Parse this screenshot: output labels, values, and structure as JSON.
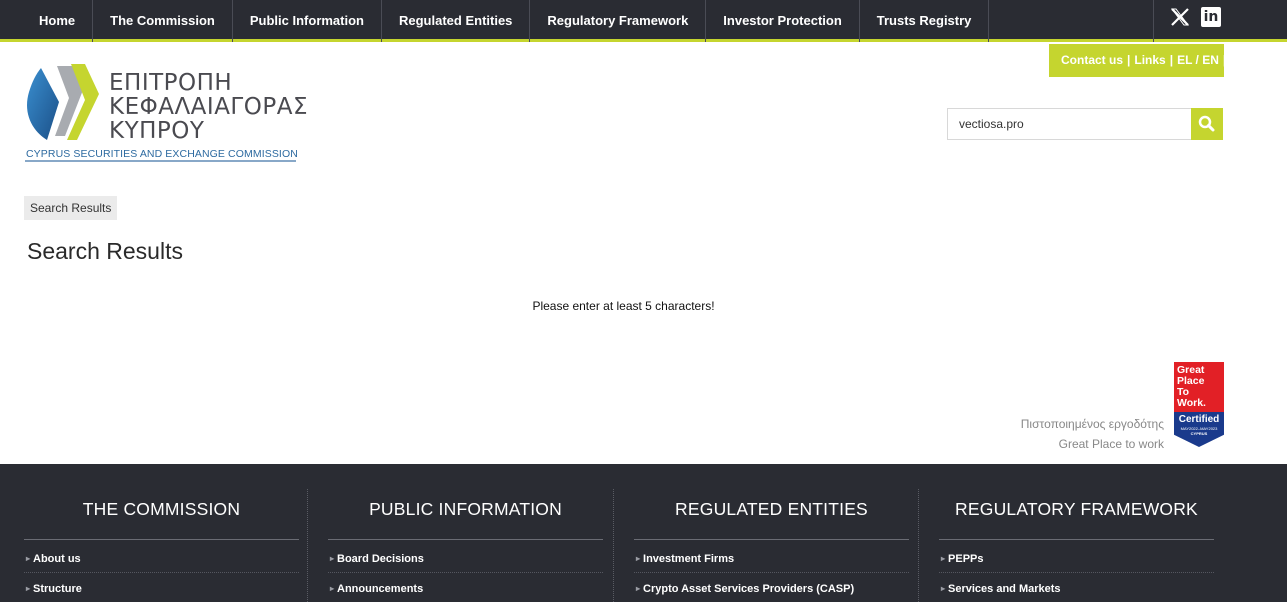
{
  "nav": {
    "items": [
      "Home",
      "The Commission",
      "Public Information",
      "Regulated Entities",
      "Regulatory Framework",
      "Investor Protection",
      "Trusts Registry"
    ]
  },
  "social": {
    "icons": [
      "x-icon",
      "linkedin-icon"
    ],
    "linkedin_glyph": "in"
  },
  "contact": {
    "contact_label": "Contact us",
    "links_label": "Links",
    "lang_label": "EL / EN",
    "sep": "|"
  },
  "logo": {
    "greek_line1": "ΕΠΙΤΡΟΠΗ",
    "greek_line2": "ΚΕΦΑΛΑΙΑΓΟΡΑΣ",
    "greek_line3": "ΚΥΠΡΟΥ",
    "english": "CYPRUS SECURITIES AND EXCHANGE COMMISSION"
  },
  "search": {
    "value": "vectiosa.pro",
    "button_icon": "search-icon"
  },
  "breadcrumb": "Search Results",
  "heading": "Search Results",
  "message": "Please enter at least 5 characters!",
  "gptw": {
    "line1": "Πιστοποιημένος εργοδότης",
    "line2": "Great Place to work",
    "badge_l1": "Great",
    "badge_l2": "Place",
    "badge_l3": "To",
    "badge_l4": "Work.",
    "badge_cert": "Certified",
    "badge_period": "MAY2022–MAY2023",
    "badge_country": "CYPRUS"
  },
  "footer": {
    "columns": [
      {
        "title": "THE COMMISSION",
        "links": [
          "About us",
          "Structure"
        ]
      },
      {
        "title": "PUBLIC INFORMATION",
        "links": [
          "Board Decisions",
          "Announcements"
        ]
      },
      {
        "title": "REGULATED ENTITIES",
        "links": [
          "Investment Firms",
          "Crypto Asset Services Providers (CASP)"
        ]
      },
      {
        "title": "REGULATORY FRAMEWORK",
        "links": [
          "PEPPs",
          "Services and Markets"
        ]
      }
    ]
  },
  "colors": {
    "nav_bg": "#2a2c33",
    "accent": "#c5d52f",
    "logo_blue": "#2d6aa0"
  }
}
